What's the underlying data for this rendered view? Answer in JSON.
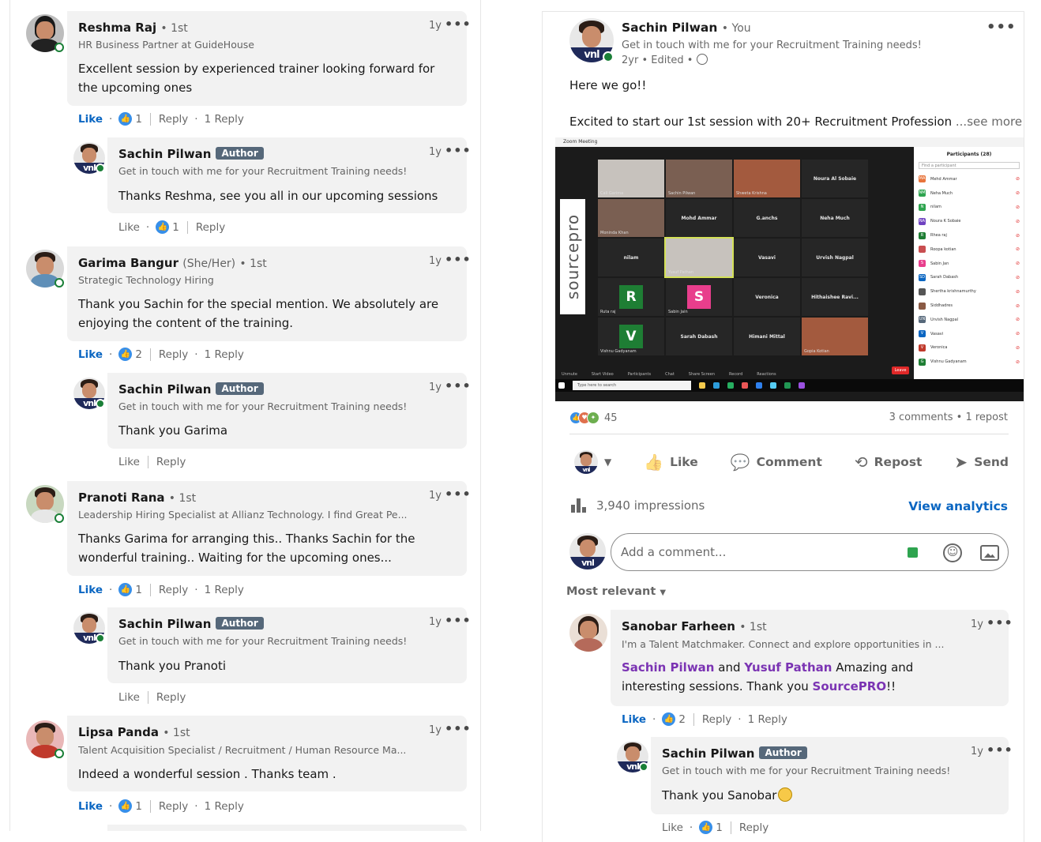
{
  "left_comments": [
    {
      "name": "Reshma Raj",
      "degree": "• 1st",
      "headline": "HR Business Partner at GuideHouse",
      "time": "1y",
      "text": "Excellent session by experienced trainer looking forward for the upcoming ones",
      "like": "Like",
      "reactions": "1",
      "reply": "Reply",
      "replies": "1 Reply",
      "reply_comment": {
        "name": "Sachin Pilwan",
        "badge": "Author",
        "headline": "Get in touch with me for your Recruitment Training needs!",
        "time": "1y",
        "text": "Thanks Reshma, see you all in our upcoming sessions",
        "like": "Like",
        "reactions": "1",
        "reply": "Reply"
      }
    },
    {
      "name": "Garima Bangur",
      "pronoun": "(She/Her)",
      "degree": "• 1st",
      "headline": "Strategic Technology Hiring",
      "time": "1y",
      "text": "Thank you Sachin for the special mention. We absolutely are enjoying the content of the training.",
      "like": "Like",
      "reactions": "2",
      "reply": "Reply",
      "replies": "1 Reply",
      "reply_comment": {
        "name": "Sachin Pilwan",
        "badge": "Author",
        "headline": "Get in touch with me for your Recruitment Training needs!",
        "time": "1y",
        "text": "Thank you Garima",
        "like": "Like",
        "reply": "Reply"
      }
    },
    {
      "name": "Pranoti Rana",
      "degree": "• 1st",
      "headline": "Leadership Hiring Specialist at Allianz Technology. I find Great Pe...",
      "time": "1y",
      "text": "Thanks Garima for arranging this.. Thanks Sachin for the wonderful training.. Waiting for the upcoming ones...",
      "like": "Like",
      "reactions": "1",
      "reply": "Reply",
      "replies": "1 Reply",
      "reply_comment": {
        "name": "Sachin Pilwan",
        "badge": "Author",
        "headline": "Get in touch with me for your Recruitment Training needs!",
        "time": "1y",
        "text": "Thank you Pranoti",
        "like": "Like",
        "reply": "Reply"
      }
    },
    {
      "name": "Lipsa Panda",
      "degree": "• 1st",
      "headline": "Talent Acquisition Specialist / Recruitment / Human Resource Ma...",
      "time": "1y",
      "text": "Indeed a wonderful session . Thanks team .",
      "like": "Like",
      "reactions": "1",
      "reply": "Reply",
      "replies": "1 Reply"
    }
  ],
  "post": {
    "author": "Sachin Pilwan",
    "you": "• You",
    "headline": "Get in touch with me for your Recruitment Training needs!",
    "meta": "2yr • Edited •",
    "line1": "Here we go!!",
    "line2": "Excited to start our 1st session with 20+ Recruitment Profession",
    "see_more": "...see more",
    "menu": "•••",
    "reaction_count": "45",
    "comments_reposts": "3 comments • 1 repost",
    "actions": {
      "like": "Like",
      "comment": "Comment",
      "repost": "Repost",
      "send": "Send"
    },
    "impressions": "3,940 impressions",
    "view_analytics": "View analytics",
    "comment_placeholder": "Add a comment...",
    "sort_label": "Most relevant"
  },
  "zoom": {
    "title": "Zoom Meeting",
    "brand": "sourcepro",
    "participants_title": "Participants (28)",
    "find_placeholder": "Find a participant",
    "taskbar_search": "Type here to search",
    "leave": "Leave",
    "tiles": [
      {
        "label": "",
        "name": "Call Garima"
      },
      {
        "label": "",
        "name": "Sachin Pilwan"
      },
      {
        "label": "",
        "name": "Shweta Krishna"
      },
      {
        "label": "Noura Al Sobaie",
        "name": ""
      },
      {
        "label": "",
        "name": "Moninda Khan"
      },
      {
        "label": "Mohd Ammar",
        "name": ""
      },
      {
        "label": "G.anchs",
        "name": ""
      },
      {
        "label": "Neha Much",
        "name": ""
      },
      {
        "label": "nilam",
        "name": ""
      },
      {
        "label": "",
        "name": "Yusuf Pathan"
      },
      {
        "label": "Vasavi",
        "name": ""
      },
      {
        "label": "Urvish Nagpal",
        "name": ""
      },
      {
        "label": "R",
        "name": "Ruta raj"
      },
      {
        "label": "S",
        "name": "Sabin Jain"
      },
      {
        "label": "Veronica",
        "name": ""
      },
      {
        "label": "Hithaishee Ravi...",
        "name": ""
      },
      {
        "label": "V",
        "name": "Vishnu Gadyanam"
      },
      {
        "label": "Sarah Dabash",
        "name": ""
      },
      {
        "label": "Himani Mittal",
        "name": ""
      },
      {
        "label": "",
        "name": "Gopia Kotian"
      }
    ],
    "participant_rows": [
      {
        "initials": "MA",
        "name": "Mehd Ammar",
        "color": "#e8743b"
      },
      {
        "initials": "NM",
        "name": "Neha Much",
        "color": "#2ea44f"
      },
      {
        "initials": "N",
        "name": "nilam",
        "color": "#2ea44f"
      },
      {
        "initials": "NA",
        "name": "Noura K Sobaie",
        "color": "#6f42c1"
      },
      {
        "initials": "R",
        "name": "Rhea raj",
        "color": "#1e7e34"
      },
      {
        "initials": "",
        "name": "Roopa kotian",
        "color": "#c94e50"
      },
      {
        "initials": "S",
        "name": "Sabin Jan",
        "color": "#e83e8c"
      },
      {
        "initials": "SD",
        "name": "Sarah Dabash",
        "color": "#0a66c2"
      },
      {
        "initials": "",
        "name": "Shertha krishnamurthy",
        "color": "#555555"
      },
      {
        "initials": "",
        "name": "Siddhadres",
        "color": "#8a5a44"
      },
      {
        "initials": "UN",
        "name": "Urvish Nagpal",
        "color": "#56687a"
      },
      {
        "initials": "V",
        "name": "Vasavi",
        "color": "#0a66c2"
      },
      {
        "initials": "V",
        "name": "Veronica",
        "color": "#c0392b"
      },
      {
        "initials": "G",
        "name": "Vishnu Gadyanam",
        "color": "#1e7e34"
      }
    ],
    "toolbar": [
      "Unmute",
      "Start Video",
      "Participants",
      "Chat",
      "Share Screen",
      "Record",
      "Reactions"
    ]
  },
  "right_comments": [
    {
      "name": "Sanobar Farheen",
      "degree": "• 1st",
      "headline": "I'm a Talent Matchmaker. Connect and explore opportunities in ...",
      "time": "1y",
      "mention1": "Sachin Pilwan",
      "and": " and ",
      "mention2": "Yusuf Pathan",
      "text_mid": " Amazing and interesting sessions. Thank you ",
      "mention3": "SourcePRO",
      "text_end": "!!",
      "like": "Like",
      "reactions": "2",
      "reply": "Reply",
      "replies": "1 Reply",
      "reply_comment": {
        "name": "Sachin Pilwan",
        "badge": "Author",
        "headline": "Get in touch with me for your Recruitment Training needs!",
        "time": "1y",
        "text": "Thank you Sanobar",
        "like": "Like",
        "reactions": "1",
        "reply": "Reply"
      }
    }
  ],
  "colors": {
    "link_blue": "#0a66c2",
    "mention_purple": "#7b34b3",
    "author_badge": "#56687a",
    "bubble_gray": "#f2f2f2",
    "online_green": "#1a7f37"
  },
  "menu_dots": "•••",
  "icons": {
    "reaction_thumb": "like-reaction-icon",
    "globe": "globe-icon",
    "emoji": "emoji-icon",
    "image": "image-icon",
    "analytics": "bar-chart-icon"
  }
}
